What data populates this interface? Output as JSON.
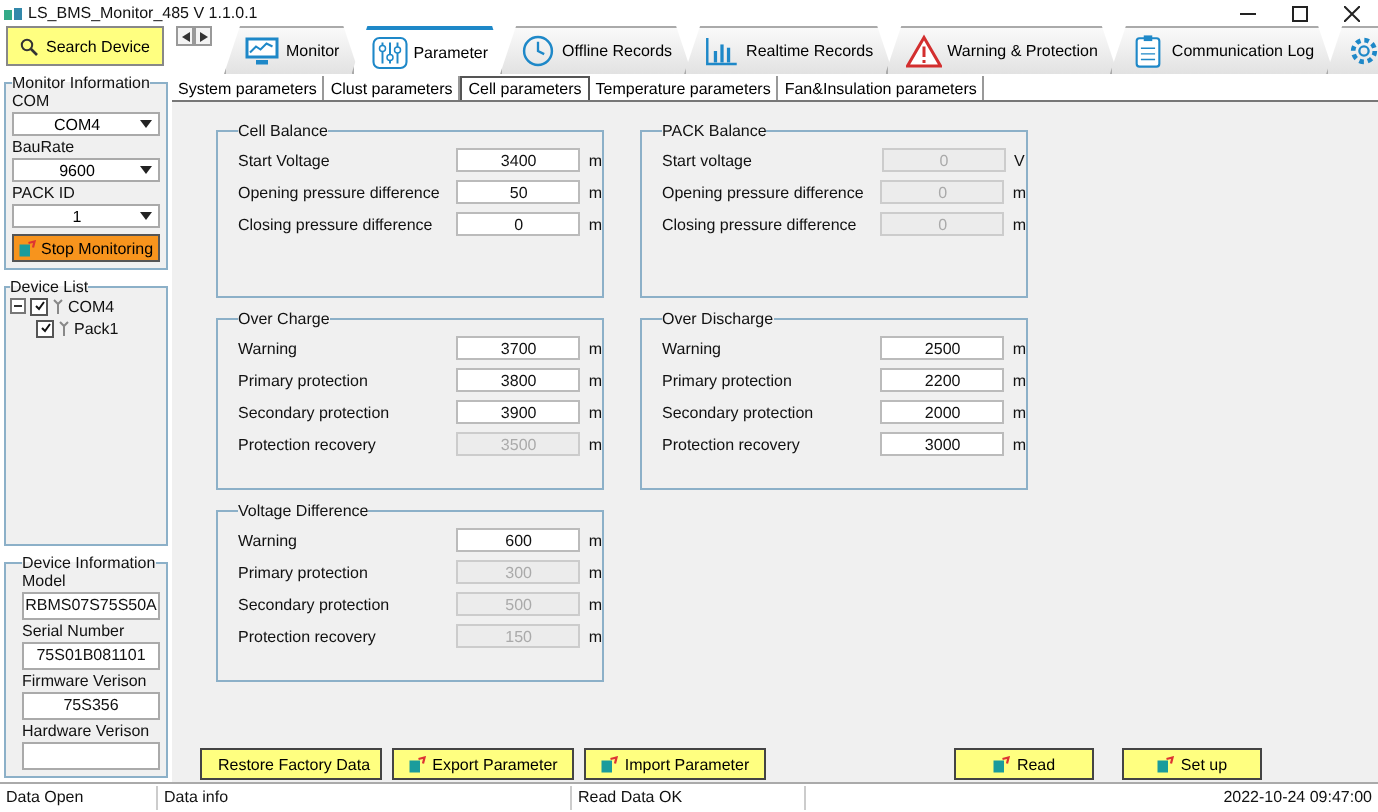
{
  "window": {
    "title": "LS_BMS_Monitor_485 V 1.1.0.1"
  },
  "search_button": "Search Device",
  "main_tabs": [
    {
      "label": "Monitor",
      "kind": "monitor",
      "selected": false
    },
    {
      "label": "Parameter",
      "kind": "sliders",
      "selected": true
    },
    {
      "label": "Offline Records",
      "kind": "clock",
      "selected": false
    },
    {
      "label": "Realtime Records",
      "kind": "bars",
      "selected": false
    },
    {
      "label": "Warning & Protection",
      "kind": "warning",
      "selected": false
    },
    {
      "label": "Communication Log",
      "kind": "clipboard",
      "selected": false
    },
    {
      "kind": "settings"
    }
  ],
  "sub_tabs": [
    {
      "label": "System parameters",
      "selected": false
    },
    {
      "label": "Clust parameters",
      "selected": false
    },
    {
      "label": "Cell parameters",
      "selected": true
    },
    {
      "label": "Temperature parameters",
      "selected": false
    },
    {
      "label": "Fan&Insulation parameters",
      "selected": false
    }
  ],
  "monitor_information": {
    "title": "Monitor Information",
    "com_label": "COM",
    "com": "COM4",
    "baudrate_label": "BauRate",
    "baudrate": "9600",
    "pack_id_label": "PACK ID",
    "pack_id": "1",
    "stop_button": "Stop Monitoring"
  },
  "device_list": {
    "title": "Device List",
    "tree": [
      {
        "label": "COM4",
        "checked": true,
        "expanded": true,
        "children": [
          {
            "label": "Pack1",
            "checked": true
          }
        ]
      }
    ]
  },
  "device_information": {
    "title": "Device Information",
    "fields": [
      {
        "label": "Model",
        "value": "RBMS07S75S50A"
      },
      {
        "label": "Serial Number",
        "value": "75S01B081101"
      },
      {
        "label": "Firmware Verison",
        "value": "75S356"
      },
      {
        "label": "Hardware Verison"
      }
    ]
  },
  "groups": [
    {
      "title": "Cell Balance",
      "fields": [
        {
          "label": "Start Voltage",
          "value": "3400",
          "unit": "m",
          "disabled": false
        },
        {
          "label": "Opening pressure difference",
          "value": "50",
          "unit": "m",
          "disabled": false
        },
        {
          "label": "Closing pressure difference",
          "value": "0",
          "unit": "m",
          "disabled": false
        }
      ]
    },
    {
      "title": "PACK Balance",
      "fields": [
        {
          "label": "Start voltage",
          "value": "0",
          "unit": "V",
          "disabled": true
        },
        {
          "label": "Opening pressure difference",
          "value": "0",
          "unit": "m",
          "disabled": true
        },
        {
          "label": "Closing pressure difference",
          "value": "0",
          "unit": "m",
          "disabled": true
        }
      ]
    },
    {
      "title": "Over Charge",
      "fields": [
        {
          "label": "Warning",
          "value": "3700",
          "unit": "m",
          "disabled": false
        },
        {
          "label": "Primary protection",
          "value": "3800",
          "unit": "m",
          "disabled": false
        },
        {
          "label": "Secondary protection",
          "value": "3900",
          "unit": "m",
          "disabled": false
        },
        {
          "label": "Protection recovery",
          "value": "3500",
          "unit": "m",
          "disabled": true
        }
      ]
    },
    {
      "title": "Over Discharge",
      "fields": [
        {
          "label": "Warning",
          "value": "2500",
          "unit": "m",
          "disabled": false
        },
        {
          "label": "Primary protection",
          "value": "2200",
          "unit": "m",
          "disabled": false
        },
        {
          "label": "Secondary protection",
          "value": "2000",
          "unit": "m",
          "disabled": false
        },
        {
          "label": "Protection recovery",
          "value": "3000",
          "unit": "m",
          "disabled": false
        }
      ]
    },
    {
      "title": "Voltage Difference",
      "fields": [
        {
          "label": "Warning",
          "value": "600",
          "unit": "m",
          "disabled": false
        },
        {
          "label": "Primary protection",
          "value": "300",
          "unit": "m",
          "disabled": true
        },
        {
          "label": "Secondary protection",
          "value": "500",
          "unit": "m",
          "disabled": true
        },
        {
          "label": "Protection recovery",
          "value": "150",
          "unit": "m",
          "disabled": true
        }
      ]
    }
  ],
  "left_buttons": [
    "Restore Factory Data",
    "Export Parameter",
    "Import Parameter"
  ],
  "right_buttons": [
    "Read",
    "Set up"
  ],
  "status_bar": [
    "Data Open",
    "Data info",
    "Read Data OK",
    "2022-10-24 09:47:00"
  ]
}
